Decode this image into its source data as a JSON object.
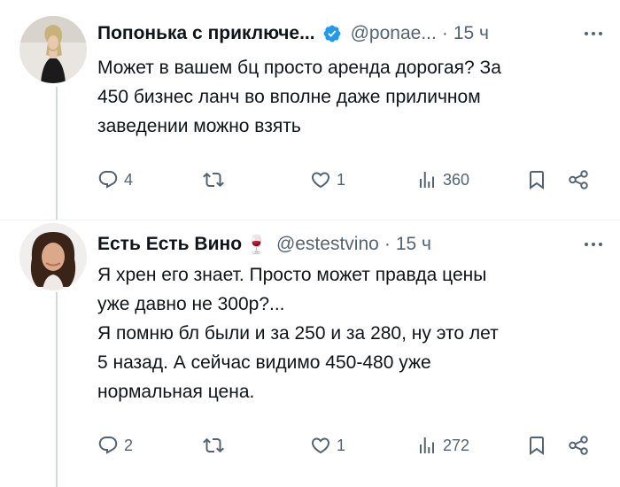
{
  "tweets": [
    {
      "name": "Попонька с приключе...",
      "verified": true,
      "handle": "@ponae...",
      "dot": "·",
      "time": "15 ч",
      "text": "Может в вашем бц просто аренда дорогая? За\n450 бизнес ланч во вполне даже приличном\nзаведении можно взять",
      "replies": "4",
      "retweets": "",
      "likes": "1",
      "views": "360"
    },
    {
      "name": "Есть Есть Вино",
      "verified": false,
      "name_emoji": "🍷",
      "handle": "@estestvino",
      "dot": "·",
      "time": "15 ч",
      "text": "Я хрен его знает. Просто может правда цены\nуже давно не 300р?...\nЯ помню бл были и за 250 и за 280, ну это лет\n5 назад. А сейчас видимо 450-480 уже\nнормальная цена.",
      "replies": "2",
      "retweets": "",
      "likes": "1",
      "views": "272"
    }
  ],
  "colors": {
    "text": "#0f1419",
    "secondary": "#536471",
    "verified": "#1d9bf0",
    "thread_line": "#cfd9de"
  }
}
